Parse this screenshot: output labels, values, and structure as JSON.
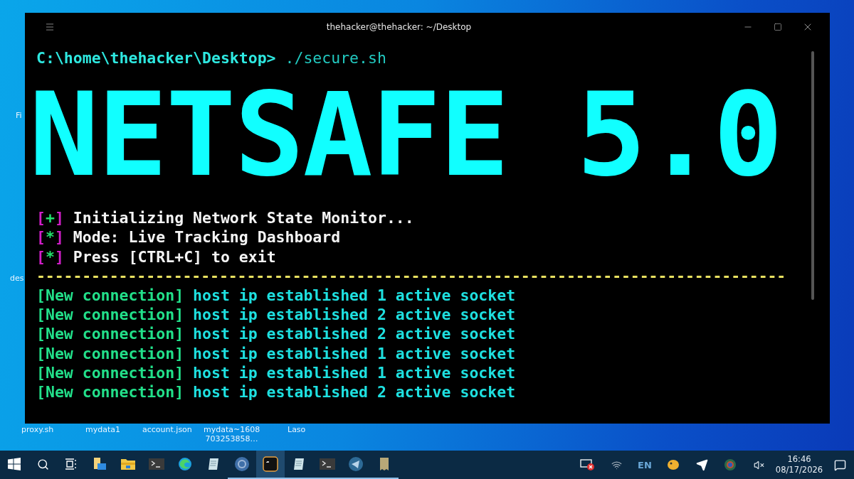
{
  "window": {
    "title": "thehacker@thehacker: ~/Desktop"
  },
  "terminal": {
    "prompt": "C:\\home\\thehacker\\Desktop>",
    "command": "./secure.sh",
    "banner": "NETSAFE 5.0",
    "messages": [
      {
        "marker": "[+]",
        "text": "Initializing Network State Monitor..."
      },
      {
        "marker": "[*]",
        "text": "Mode: Live Tracking Dashboard"
      },
      {
        "marker": "[*]",
        "text": "Press [CTRL+C] to exit"
      }
    ],
    "separator": "----------------------------------------------------------------------------------",
    "connections": [
      {
        "tag": "[New connection]",
        "text": "host ip established 1 active socket"
      },
      {
        "tag": "[New connection]",
        "text": "host ip established 2 active socket"
      },
      {
        "tag": "[New connection]",
        "text": "host ip established 2 active socket"
      },
      {
        "tag": "[New connection]",
        "text": "host ip established 1 active socket"
      },
      {
        "tag": "[New connection]",
        "text": "host ip established 1 active socket"
      },
      {
        "tag": "[New connection]",
        "text": "host ip established 2 active socket"
      }
    ]
  },
  "desktop": {
    "left_labels": [
      "Fi",
      "des"
    ],
    "bottom_labels": [
      "proxy.sh",
      "mydata1",
      "account.json",
      "mydata~1608\n703253858…",
      "Laso"
    ]
  },
  "taskbar": {
    "apps": [
      {
        "kind": "start",
        "selected": false,
        "running": false
      },
      {
        "kind": "search",
        "selected": false,
        "running": false
      },
      {
        "kind": "taskview",
        "selected": false,
        "running": false
      },
      {
        "kind": "files",
        "selected": false,
        "running": false
      },
      {
        "kind": "folder",
        "selected": false,
        "running": false
      },
      {
        "kind": "terminal",
        "selected": false,
        "running": false
      },
      {
        "kind": "edge",
        "selected": false,
        "running": false
      },
      {
        "kind": "notepad",
        "selected": false,
        "running": false
      },
      {
        "kind": "chrome",
        "selected": false,
        "running": true
      },
      {
        "kind": "console",
        "selected": true,
        "running": true
      },
      {
        "kind": "notepad",
        "selected": false,
        "running": true
      },
      {
        "kind": "terminal",
        "selected": false,
        "running": true
      },
      {
        "kind": "telegram",
        "selected": false,
        "running": true
      },
      {
        "kind": "document",
        "selected": false,
        "running": true
      }
    ],
    "tray": {
      "language": "EN",
      "time": "16:46",
      "date": "08/17/2026"
    }
  }
}
